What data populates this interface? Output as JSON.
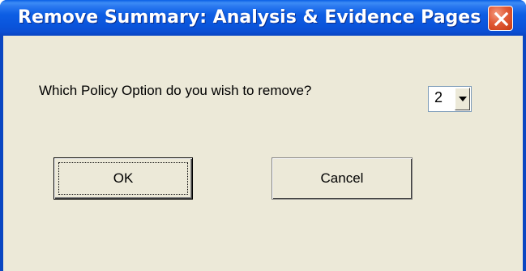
{
  "dialog": {
    "title": "Remove Summary: Analysis & Evidence Pages",
    "close_icon": "close-icon",
    "prompt": "Which Policy Option do you wish to remove?",
    "option_select": {
      "value": "2",
      "arrow_icon": "chevron-down-icon"
    },
    "ok_label": "OK",
    "cancel_label": "Cancel"
  },
  "colors": {
    "titlebar": "#0a55dc",
    "client_background": "#ece9d8",
    "close_button": "#e15a36"
  }
}
